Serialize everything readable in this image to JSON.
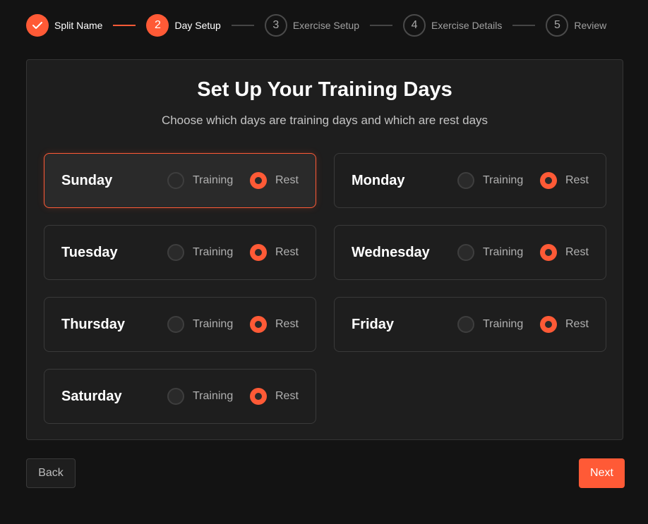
{
  "stepper": {
    "steps": [
      {
        "number": "1",
        "label": "Split Name",
        "state": "done"
      },
      {
        "number": "2",
        "label": "Day Setup",
        "state": "active"
      },
      {
        "number": "3",
        "label": "Exercise Setup",
        "state": "pending"
      },
      {
        "number": "4",
        "label": "Exercise Details",
        "state": "pending"
      },
      {
        "number": "5",
        "label": "Review",
        "state": "pending"
      }
    ]
  },
  "main": {
    "title": "Set Up Your Training Days",
    "subtitle": "Choose which days are training days and which are rest days",
    "option_training": "Training",
    "option_rest": "Rest",
    "days": [
      {
        "name": "Sunday",
        "selection": "Rest",
        "focused": true
      },
      {
        "name": "Monday",
        "selection": "Rest",
        "focused": false
      },
      {
        "name": "Tuesday",
        "selection": "Rest",
        "focused": false
      },
      {
        "name": "Wednesday",
        "selection": "Rest",
        "focused": false
      },
      {
        "name": "Thursday",
        "selection": "Rest",
        "focused": false
      },
      {
        "name": "Friday",
        "selection": "Rest",
        "focused": false
      },
      {
        "name": "Saturday",
        "selection": "Rest",
        "focused": false
      }
    ]
  },
  "footer": {
    "back_label": "Back",
    "next_label": "Next"
  },
  "colors": {
    "accent": "#ff5a36",
    "background": "#131313",
    "panel": "#1e1e1e"
  }
}
